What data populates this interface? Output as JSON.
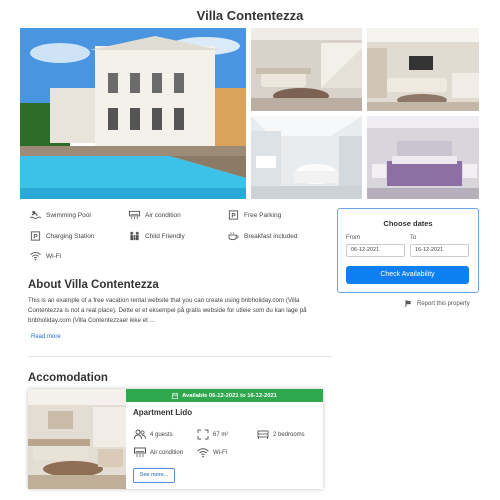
{
  "page": {
    "title": "Villa Contentezza"
  },
  "amenities": [
    {
      "label": "Swimming Pool",
      "icon": "swimming-pool-icon"
    },
    {
      "label": "Air condition",
      "icon": "air-condition-icon"
    },
    {
      "label": "Free Parking",
      "icon": "parking-icon"
    },
    {
      "label": "Charging Station",
      "icon": "charging-station-icon"
    },
    {
      "label": "Child Friendly",
      "icon": "child-friendly-icon"
    },
    {
      "label": "Breakfast included",
      "icon": "breakfast-icon"
    },
    {
      "label": "Wi-Fi",
      "icon": "wifi-icon"
    }
  ],
  "booking": {
    "title": "Choose dates",
    "from_label": "From",
    "to_label": "To",
    "from_value": "06-12-2021",
    "to_value": "16-12-2021",
    "button_label": "Check Availability",
    "accent_color": "#0d7ff0"
  },
  "report": {
    "label": "Report this property"
  },
  "about": {
    "heading": "About Villa Contentezza",
    "text_line1": "This is an example of a free vacation rental website that you can create using bnbholiday.com (Villa",
    "text_line2": "Contentezza is not a real place). Dette er et eksempel på gratis webside for utleie som du kan lage på",
    "text_line3": "bnbholiday.com (Villa Contentezzaer ikke et ...",
    "read_more": "Read more"
  },
  "accommodation": {
    "heading": "Accomodation",
    "availability": "Available 06-12-2021 to 16-12-2021",
    "availability_color": "#2fa84f",
    "name": "Apartment Lido",
    "guests": "4 guests",
    "size": "67 m²",
    "bedrooms": "2 bedrooms",
    "aircon": "Air condition",
    "wifi": "Wi-Fi",
    "see_more": "See more..."
  }
}
